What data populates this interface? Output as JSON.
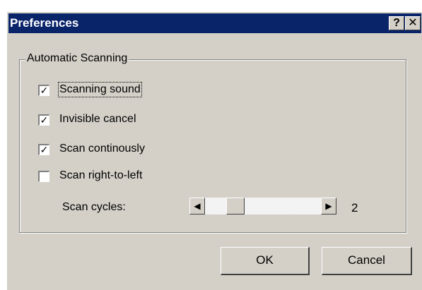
{
  "dialog": {
    "title": "Preferences",
    "help_glyph": "?",
    "close_glyph": "✕"
  },
  "group": {
    "label": "Automatic Scanning",
    "checkboxes": [
      {
        "label": "Scanning sound",
        "mnemonic": "S",
        "checked": true
      },
      {
        "label": "Invisible cancel",
        "mnemonic": "I",
        "checked": true
      },
      {
        "label": "Scan continously",
        "mnemonic": "n",
        "checked": true
      },
      {
        "label": "Scan right-to-left",
        "mnemonic": "r",
        "checked": false
      }
    ]
  },
  "scan_cycles": {
    "label": "Scan cycles:",
    "value": "2"
  },
  "buttons": {
    "ok": "OK",
    "cancel": "Cancel"
  },
  "icons": {
    "scroll_left": "left-arrow-icon",
    "scroll_right": "right-arrow-icon",
    "check": "checkmark-icon"
  },
  "colors": {
    "titlebar": "#0a246a",
    "face": "#d4d0c8"
  }
}
